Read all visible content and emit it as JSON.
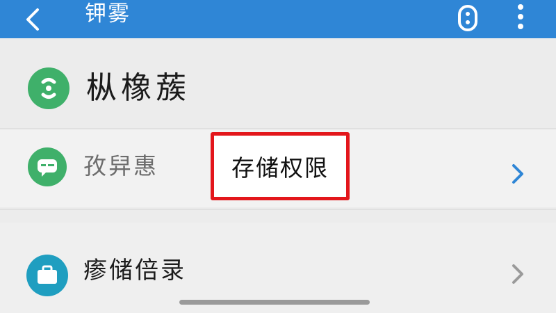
{
  "topbar": {
    "title": "钾雾",
    "back_icon": "chevron-left-icon",
    "capsule_icon": "capsule-icon",
    "more_icon": "more-vertical-icon",
    "color": "#2f86d6"
  },
  "app": {
    "name": "枞橡蔟",
    "icon": "app-logo-icon",
    "icon_color": "#3fb06a"
  },
  "permissions_row": {
    "label": "孜舁惠",
    "icon": "chat-bubble-icon",
    "highlight_text": "存储权限",
    "highlight_color": "#e3161b",
    "chevron_icon": "chevron-right-icon"
  },
  "storage_row": {
    "label": "瘆储倍录",
    "icon": "briefcase-icon",
    "icon_color": "#1f9ec0",
    "chevron_icon": "chevron-right-icon"
  }
}
